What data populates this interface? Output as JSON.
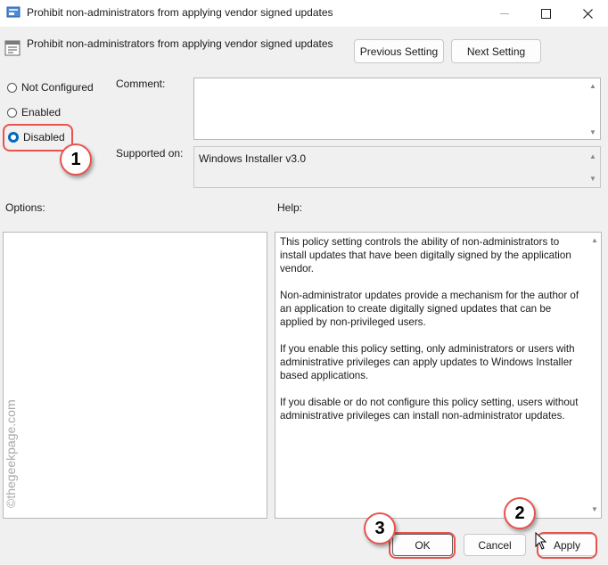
{
  "window": {
    "title": "Prohibit non-administrators from applying vendor signed updates"
  },
  "header": {
    "policy_name": "Prohibit non-administrators from applying vendor signed updates",
    "previous_label": "Previous Setting",
    "next_label": "Next Setting"
  },
  "state": {
    "options": [
      {
        "label": "Not Configured",
        "selected": false
      },
      {
        "label": "Enabled",
        "selected": false
      },
      {
        "label": "Disabled",
        "selected": true
      }
    ]
  },
  "fields": {
    "comment_label": "Comment:",
    "comment_value": "",
    "supported_label": "Supported on:",
    "supported_value": "Windows Installer v3.0"
  },
  "panels": {
    "options_label": "Options:",
    "help_label": "Help:",
    "help_paragraphs": [
      "This policy setting controls the ability of non-administrators to install updates that have been digitally signed by the application vendor.",
      "Non-administrator updates provide a mechanism for the author of an application to create digitally signed updates that can be applied by non-privileged users.",
      "If you enable this policy setting, only administrators or users with administrative privileges can apply updates to Windows Installer based applications.",
      "If you disable or do not configure this policy setting, users without administrative privileges can install non-administrator updates."
    ]
  },
  "footer": {
    "ok_label": "OK",
    "cancel_label": "Cancel",
    "apply_label": "Apply"
  },
  "annotations": {
    "step1": "1",
    "step2": "2",
    "step3": "3",
    "watermark": "©thegeekpage.com",
    "highlight_color": "#e8534e"
  },
  "colors": {
    "accent": "#0067c0"
  }
}
